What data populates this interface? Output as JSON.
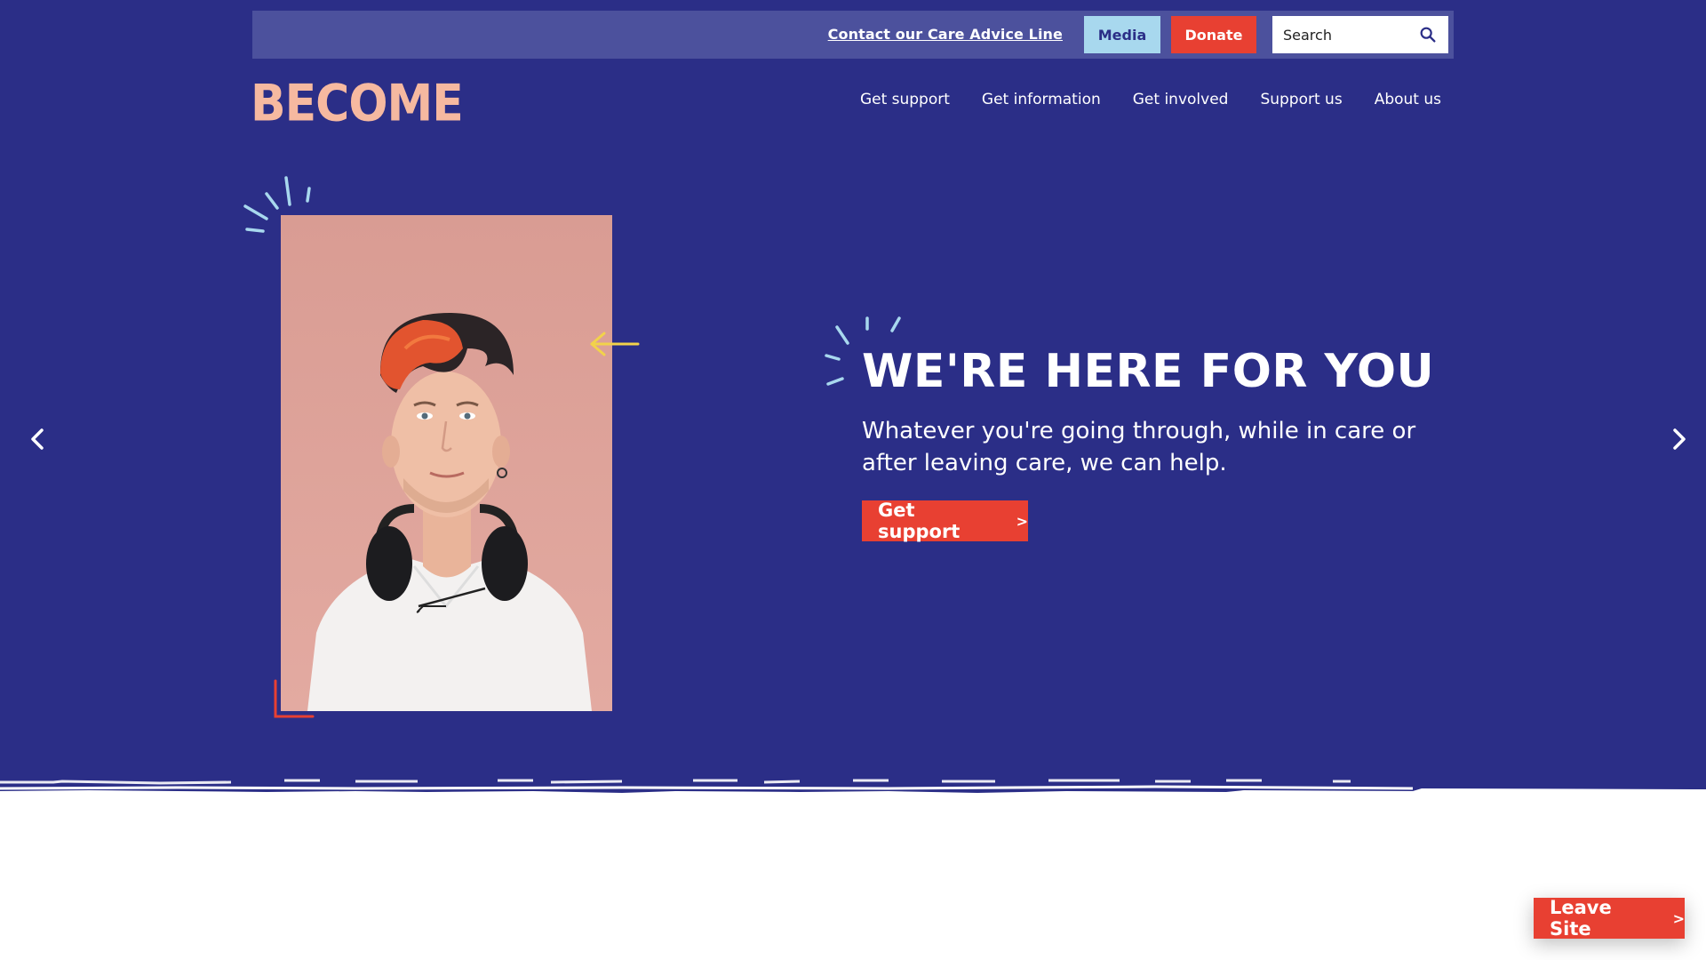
{
  "brand": {
    "logo_text": "BECOME",
    "colors": {
      "navy": "#2b2e87",
      "utility_bar": "#4c519d",
      "peach": "#f6b9a0",
      "red": "#e84032",
      "light_blue": "#a8d8ee",
      "yellow": "#f2d24a"
    }
  },
  "utility": {
    "care_link": "Contact our Care Advice Line",
    "media_label": "Media",
    "donate_label": "Donate",
    "search_placeholder": "Search",
    "search_icon": "search-icon"
  },
  "nav": {
    "items": [
      {
        "label": "Get support"
      },
      {
        "label": "Get information"
      },
      {
        "label": "Get involved"
      },
      {
        "label": "Support us"
      },
      {
        "label": "About us"
      }
    ]
  },
  "hero": {
    "heading": "WE'RE HERE FOR YOU",
    "subheading": "Whatever you're going through, while in care or after leaving care, we can help.",
    "cta_label": "Get support",
    "cta_chevron": ">",
    "prev_icon": "chevron-left-icon",
    "next_icon": "chevron-right-icon",
    "photo": "young-person-with-headphones-photo"
  },
  "floating": {
    "leave_label": "Leave Site",
    "leave_chevron": ">"
  }
}
